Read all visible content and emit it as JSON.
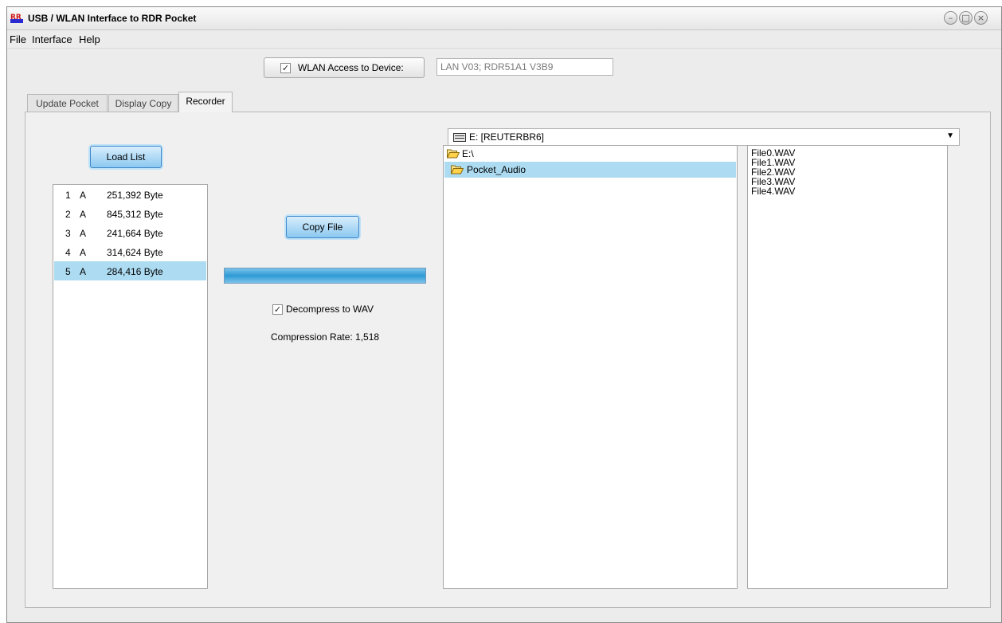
{
  "window": {
    "title": "USB / WLAN Interface to RDR Pocket"
  },
  "menu": [
    "File",
    "Interface",
    "Help"
  ],
  "wlan": {
    "label": "WLAN Access to Device:",
    "checked": true,
    "device_info": "LAN V03; RDR51A1 V3B9"
  },
  "tabs": [
    "Update Pocket",
    "Display Copy",
    "Recorder"
  ],
  "active_tab": "Recorder",
  "recorder": {
    "load_list_label": "Load List",
    "recordings": [
      {
        "index": "1",
        "flag": "A",
        "size": "251,392 Byte"
      },
      {
        "index": "2",
        "flag": "A",
        "size": "845,312 Byte"
      },
      {
        "index": "3",
        "flag": "A",
        "size": "241,664 Byte"
      },
      {
        "index": "4",
        "flag": "A",
        "size": "314,624 Byte"
      },
      {
        "index": "5",
        "flag": "A",
        "size": "284,416 Byte"
      }
    ],
    "selected_recording": "5",
    "copy_file_label": "Copy File",
    "progress": 1.0,
    "decompress_label": "Decompress to WAV",
    "decompress_checked": true,
    "compression_rate": "Compression Rate: 1,518"
  },
  "drive": {
    "selected": "E: [REUTERBR6]"
  },
  "folders": [
    {
      "name": "E:\\",
      "icon": "open-folder-icon"
    },
    {
      "name": "Pocket_Audio",
      "icon": "open-folder-icon",
      "selected": true
    }
  ],
  "files": [
    "File0.WAV",
    "File1.WAV",
    "File2.WAV",
    "File3.WAV",
    "File4.WAV"
  ],
  "colors": {
    "selection": "#addcf2",
    "button_blue": "#8cc8f0",
    "progress_blue": "#2e9ad5"
  }
}
